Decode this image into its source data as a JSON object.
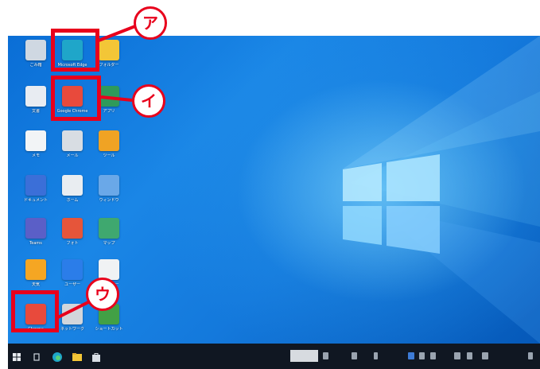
{
  "desktop": {
    "wallpaper": "windows-10-hero",
    "icons": [
      {
        "id": "recycle",
        "label": "ごみ箱",
        "icon": "recycle-bin-icon",
        "color": "#cfd8e2"
      },
      {
        "id": "edge",
        "label": "Microsoft Edge",
        "icon": "edge-browser-icon",
        "color": "#1fa6c9"
      },
      {
        "id": "folder",
        "label": "フォルダー",
        "icon": "folder-icon",
        "color": "#f3c637"
      },
      {
        "id": "doc1",
        "label": "文書",
        "icon": "document-icon",
        "color": "#e8ecf2"
      },
      {
        "id": "chrome",
        "label": "Google Chrome",
        "icon": "chrome-browser-icon",
        "color": "#e84a3c"
      },
      {
        "id": "app1",
        "label": "アプリ",
        "icon": "app-icon",
        "color": "#2f9a5a"
      },
      {
        "id": "doc2",
        "label": "メモ",
        "icon": "notepad-icon",
        "color": "#f2f4f6"
      },
      {
        "id": "mail",
        "label": "メール",
        "icon": "mail-icon",
        "color": "#d8dde3"
      },
      {
        "id": "tool",
        "label": "ツール",
        "icon": "tool-icon",
        "color": "#f0a324"
      },
      {
        "id": "folder2",
        "label": "ドキュメント",
        "icon": "folder-icon",
        "color": "#3b6fd8"
      },
      {
        "id": "house",
        "label": "ホーム",
        "icon": "house-icon",
        "color": "#e9edf1"
      },
      {
        "id": "window",
        "label": "ウィンドウ",
        "icon": "window-icon",
        "color": "#6aa8e8"
      },
      {
        "id": "teams",
        "label": "Teams",
        "icon": "teams-icon",
        "color": "#5b5fc7"
      },
      {
        "id": "photo",
        "label": "フォト",
        "icon": "photos-icon",
        "color": "#e6553a"
      },
      {
        "id": "map",
        "label": "マップ",
        "icon": "map-icon",
        "color": "#3fa86f"
      },
      {
        "id": "sun",
        "label": "天気",
        "icon": "weather-icon",
        "color": "#f5a623"
      },
      {
        "id": "users",
        "label": "ユーザー",
        "icon": "users-icon",
        "color": "#2b7de9"
      },
      {
        "id": "printer",
        "label": "プリンター",
        "icon": "printer-icon",
        "color": "#f0f2f4"
      },
      {
        "id": "chrome2",
        "label": "Chrome",
        "icon": "chrome-browser-icon",
        "color": "#e84a3c"
      },
      {
        "id": "network",
        "label": "ネットワーク",
        "icon": "network-icon",
        "color": "#d2d6db"
      },
      {
        "id": "shortcut",
        "label": "ショートカット",
        "icon": "shortcut-icon",
        "color": "#42a045"
      }
    ],
    "callouts": [
      {
        "id": "a",
        "text": "ア"
      },
      {
        "id": "i",
        "text": "イ"
      },
      {
        "id": "u",
        "text": "ウ"
      }
    ]
  },
  "taskbar": {
    "search_chip": "",
    "clock": ""
  },
  "colors": {
    "highlight": "#e8001c",
    "taskbar": "#101722",
    "desktop_blue": "#1479dc"
  }
}
